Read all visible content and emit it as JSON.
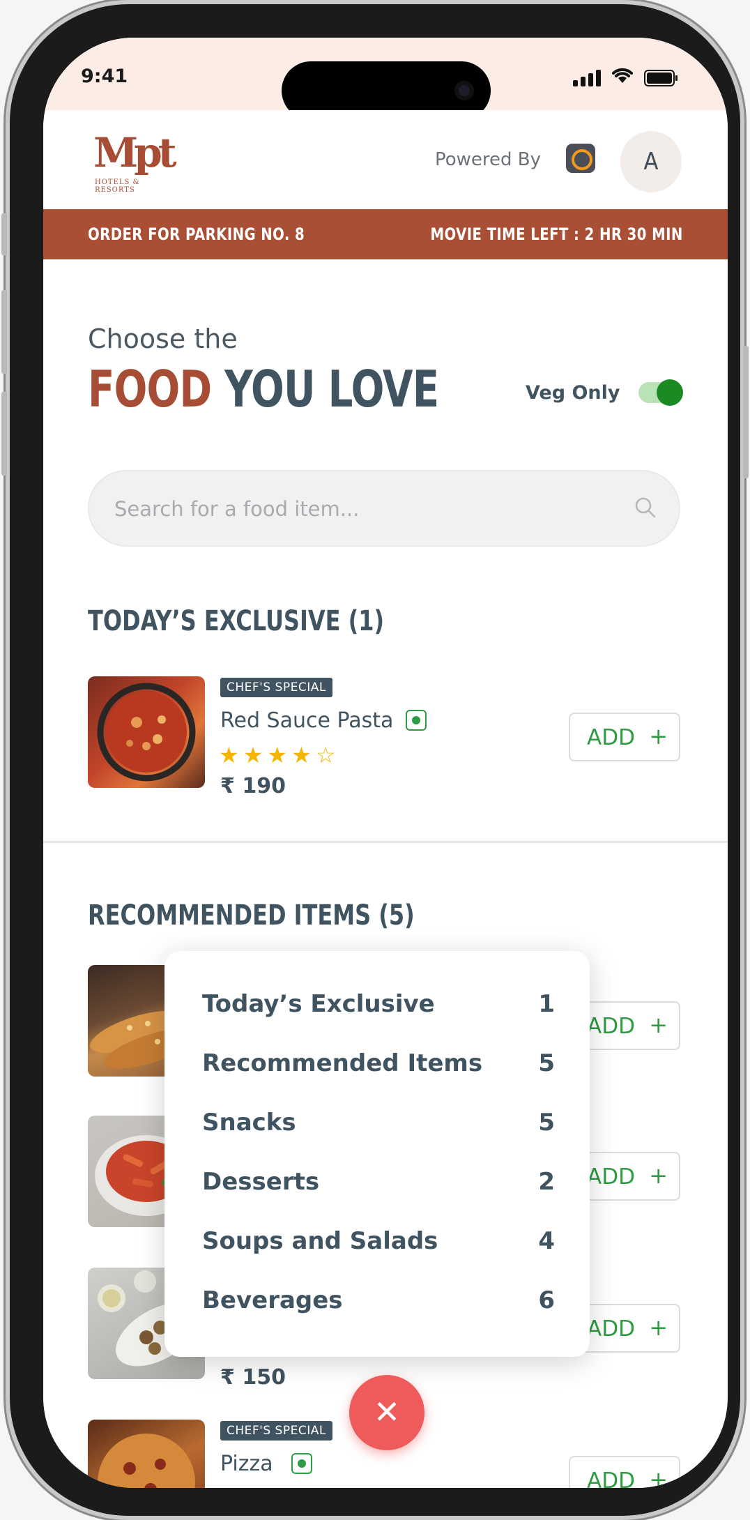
{
  "status_bar": {
    "time": "9:41"
  },
  "header": {
    "logo_text": "Mpt",
    "logo_subtext": "HOTELS & RESORTS",
    "powered_by": "Powered By",
    "avatar_initial": "A"
  },
  "order_bar": {
    "left": "ORDER FOR PARKING NO. 8",
    "right": "MOVIE TIME LEFT : 2 HR 30 MIN"
  },
  "hero": {
    "choose": "Choose the",
    "headline_accent": "FOOD",
    "headline_rest": "YOU LOVE",
    "veg_only_label": "Veg Only",
    "veg_only_on": true
  },
  "search": {
    "placeholder": "Search for a food item..."
  },
  "sections": {
    "exclusive_title": "TODAY’S EXCLUSIVE (1)",
    "recommended_title": "RECOMMENDED ITEMS (5)"
  },
  "exclusive_items": [
    {
      "badge": "CHEF'S SPECIAL",
      "name": "Red Sauce Pasta",
      "rating": 4,
      "stars": "★★★★☆",
      "price": "₹ 190",
      "add_label": "ADD",
      "add_plus": "+"
    }
  ],
  "recommended_items": [
    {
      "add_label": "ADD",
      "add_plus": "+"
    },
    {
      "add_label": "ADD",
      "add_plus": "+"
    },
    {
      "price": "₹ 150",
      "add_label": "ADD",
      "add_plus": "+"
    },
    {
      "badge": "CHEF'S SPECIAL",
      "name": "Pizza",
      "add_label": "ADD",
      "add_plus": "+"
    }
  ],
  "menu": {
    "items": [
      {
        "label": "Today’s Exclusive",
        "count": "1"
      },
      {
        "label": "Recommended Items",
        "count": "5"
      },
      {
        "label": "Snacks",
        "count": "5"
      },
      {
        "label": "Desserts",
        "count": "2"
      },
      {
        "label": "Soups and Salads",
        "count": "4"
      },
      {
        "label": "Beverages",
        "count": "6"
      }
    ]
  },
  "fab": {
    "icon": "close-icon",
    "glyph": "✕"
  },
  "colors": {
    "brand": "#a84f36",
    "text": "#3f5360",
    "veg_green": "#2e9c45",
    "star": "#f5b400",
    "fab": "#ef5a5a"
  }
}
